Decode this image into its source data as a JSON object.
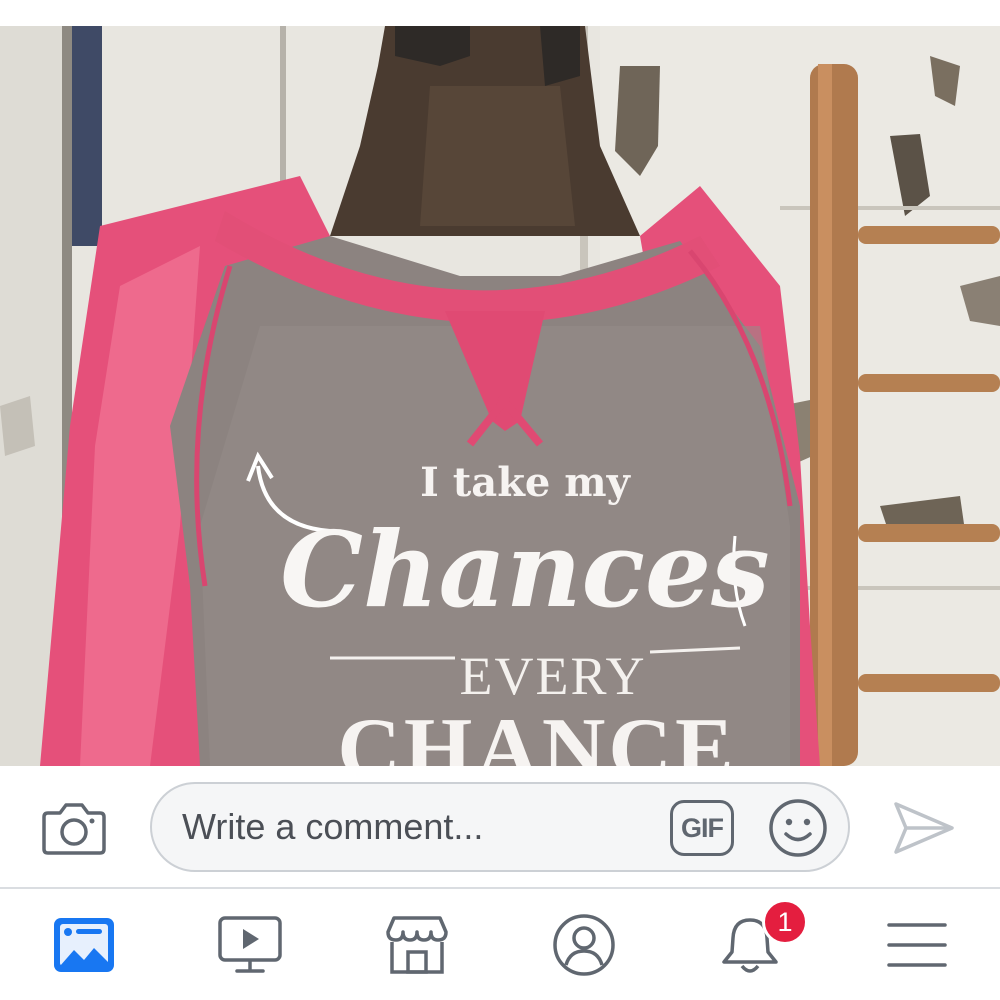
{
  "post": {
    "photo": {
      "icon": "sweatshirt-photo",
      "shirt_text": {
        "line1": "I take my",
        "line2": "Chances",
        "line3": "EVERY",
        "line4": "CHANCE"
      }
    }
  },
  "comment_bar": {
    "camera_icon": "camera-icon",
    "placeholder": "Write a comment...",
    "gif_label": "GIF",
    "emoji_icon": "smiley-icon",
    "send_icon": "send-icon"
  },
  "tab_bar": {
    "tabs": [
      {
        "id": "news-feed",
        "icon": "news-feed-icon",
        "active": true
      },
      {
        "id": "watch",
        "icon": "video-icon",
        "active": false
      },
      {
        "id": "marketplace",
        "icon": "marketplace-icon",
        "active": false
      },
      {
        "id": "profile",
        "icon": "profile-icon",
        "active": false
      },
      {
        "id": "notifications",
        "icon": "bell-icon",
        "active": false,
        "badge": "1"
      },
      {
        "id": "menu",
        "icon": "menu-icon",
        "active": false
      }
    ]
  },
  "colors": {
    "accent": "#1877f2",
    "badge": "#e41e3f",
    "icon_gray": "#606770",
    "shirt_pink": "#e8547c",
    "shirt_gray": "#8f8683"
  }
}
